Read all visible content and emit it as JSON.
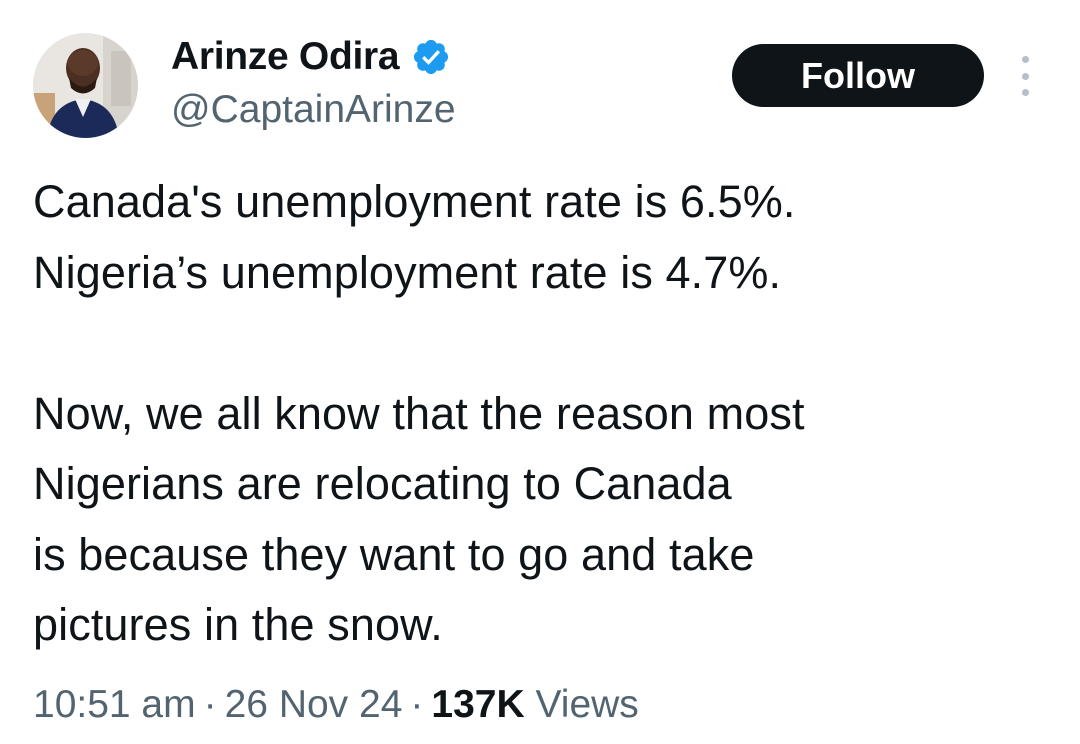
{
  "author": {
    "display_name": "Arinze Odira",
    "handle": "@CaptainArinze",
    "verified": true,
    "verified_color": "#1d9bf0"
  },
  "actions": {
    "follow_label": "Follow",
    "more_icon": "more-vertical-icon"
  },
  "tweet": {
    "lines": [
      "Canada's unemployment rate is 6.5%.",
      "Nigeria’s unemployment rate is 4.7%."
    ],
    "paragraph2": [
      "Now, we all know that the reason most",
      "Nigerians are relocating to Canada",
      "is because they want to go and take",
      "pictures in the snow."
    ]
  },
  "meta": {
    "time": "10:51 am",
    "date": "26 Nov 24",
    "views_count": "137K",
    "views_label": "Views",
    "separator": "·"
  }
}
